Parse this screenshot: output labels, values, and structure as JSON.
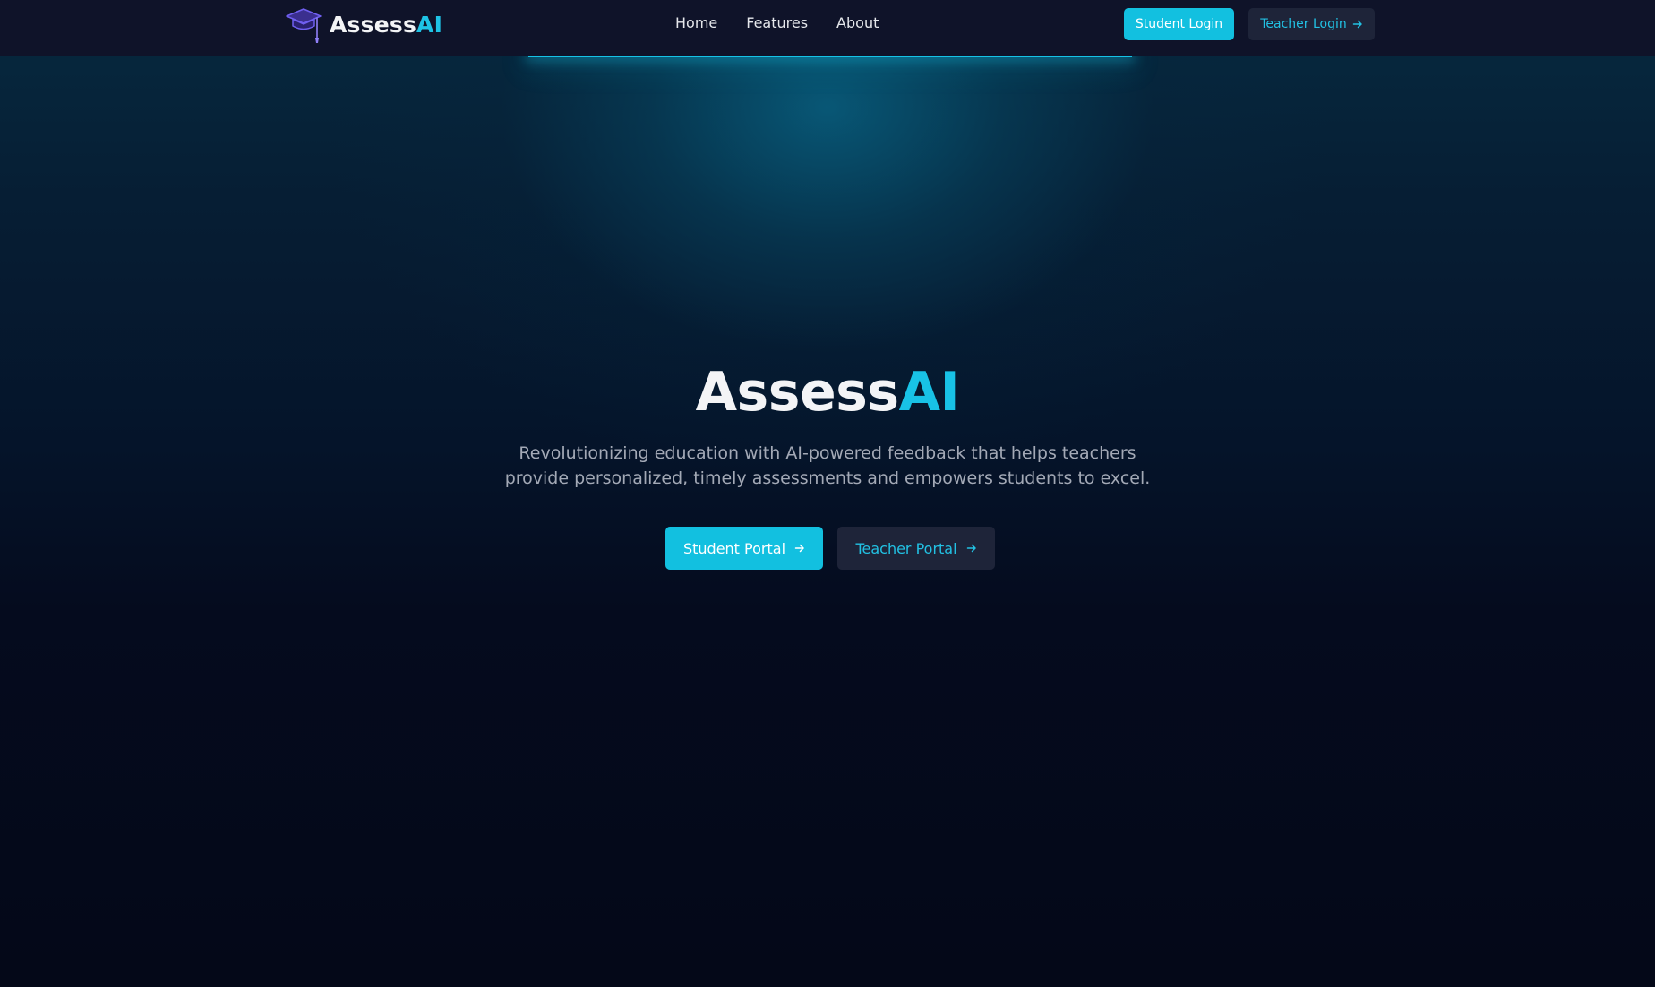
{
  "brand": {
    "name_part1": "Assess",
    "name_part2": "AI",
    "icon": "graduation-cap-icon"
  },
  "nav": {
    "items": [
      {
        "label": "Home"
      },
      {
        "label": "Features"
      },
      {
        "label": "About"
      }
    ]
  },
  "header_actions": {
    "student_login": "Student Login",
    "teacher_login": "Teacher Login",
    "teacher_login_icon": "arrow-right-icon"
  },
  "hero": {
    "title_part1": "Assess",
    "title_part2": "AI",
    "subtitle": "Revolutionizing education with AI-powered feedback that helps teachers provide personalized, timely assessments and empowers students to excel.",
    "student_portal": "Student Portal",
    "teacher_portal": "Teacher Portal",
    "button_icon": "arrow-right-icon"
  },
  "colors": {
    "accent": "#12c0e0",
    "accent_text": "#22c1e3",
    "header_bg": "#0f1329",
    "page_bg": "#050b1e",
    "secondary_button_bg": "#1e2439",
    "logo_purple": "#5b4bd6"
  }
}
